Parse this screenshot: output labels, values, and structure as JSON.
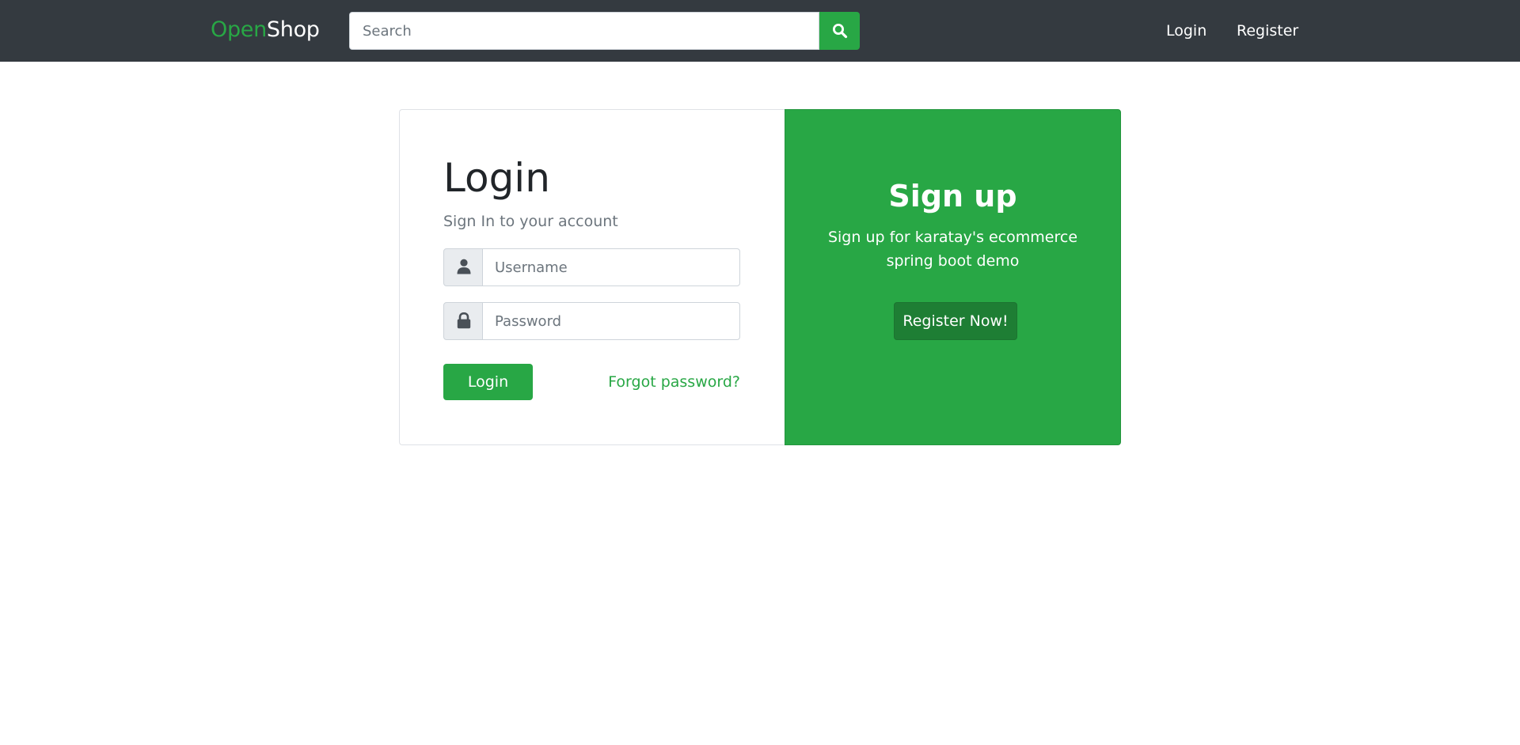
{
  "header": {
    "brand_part1": "Open",
    "brand_part2": "Shop",
    "search_placeholder": "Search",
    "search_value": "",
    "nav": {
      "login": "Login",
      "register": "Register"
    }
  },
  "login_card": {
    "title": "Login",
    "subtitle": "Sign In to your account",
    "username_placeholder": "Username",
    "username_value": "",
    "password_placeholder": "Password",
    "password_value": "",
    "login_button": "Login",
    "forgot_password": "Forgot password?"
  },
  "signup_card": {
    "title": "Sign up",
    "text": "Sign up for karatay's ecommerce spring boot demo",
    "register_button": "Register Now!"
  },
  "colors": {
    "navbar": "#343a40",
    "accent": "#28a745",
    "accent_dark": "#1e7e34"
  },
  "icons": {
    "search": "search-icon",
    "user": "user-icon",
    "lock": "lock-icon"
  }
}
